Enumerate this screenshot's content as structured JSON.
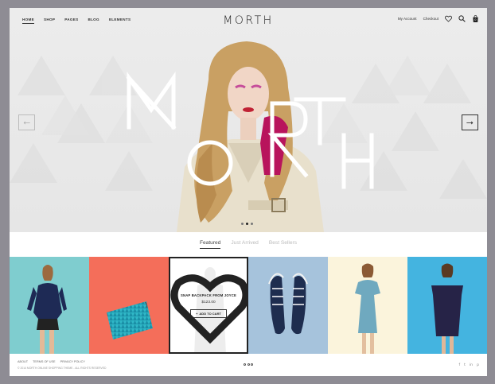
{
  "header": {
    "nav": [
      "HOME",
      "SHOP",
      "PAGES",
      "BLOG",
      "ELEMENTS"
    ],
    "logo": "MORTH",
    "links": [
      "My Account",
      "Checkout"
    ],
    "icons": [
      "heart-icon",
      "search-icon",
      "bag-icon"
    ],
    "cart_count": "0"
  },
  "hero": {
    "overlay_letters": [
      "M",
      "O",
      "R",
      "T",
      "H"
    ],
    "prev_arrow": "←",
    "next_arrow": "→",
    "slides": 3,
    "active_slide": 1
  },
  "tabs": {
    "items": [
      "Featured",
      "Just Arrived",
      "Best Sellers"
    ],
    "active": 0
  },
  "products": {
    "tiles": [
      {
        "bg": "#7fcdcf",
        "kind": "model-navy-top"
      },
      {
        "bg": "#f46e5a",
        "kind": "clutch"
      },
      {
        "bg": "#ffffff",
        "kind": "hover"
      },
      {
        "bg": "#a6c3dc",
        "kind": "sneakers"
      },
      {
        "bg": "#fbf4dc",
        "kind": "model-floral-dress"
      },
      {
        "bg": "#44b4e0",
        "kind": "model-offshoulder"
      }
    ],
    "hover_item": {
      "name": "SNAP BACKPACK FROM JOYCE",
      "price": "$123.00",
      "button": "ADD TO CART",
      "button_icon": "+"
    }
  },
  "footer": {
    "links": [
      "ABOUT",
      "TERMS OF USE",
      "PRIVACY POLICY"
    ],
    "copyright": "© 2014 MORTH ONLINE SHOPPING THEME  -  ALL RIGHTS RESERVED",
    "social": [
      "f",
      "t",
      "in",
      "p"
    ]
  },
  "colors": {
    "accent": "#222222",
    "hero_bg": "#e8e8e8",
    "page_bg": "#8e8c94"
  }
}
